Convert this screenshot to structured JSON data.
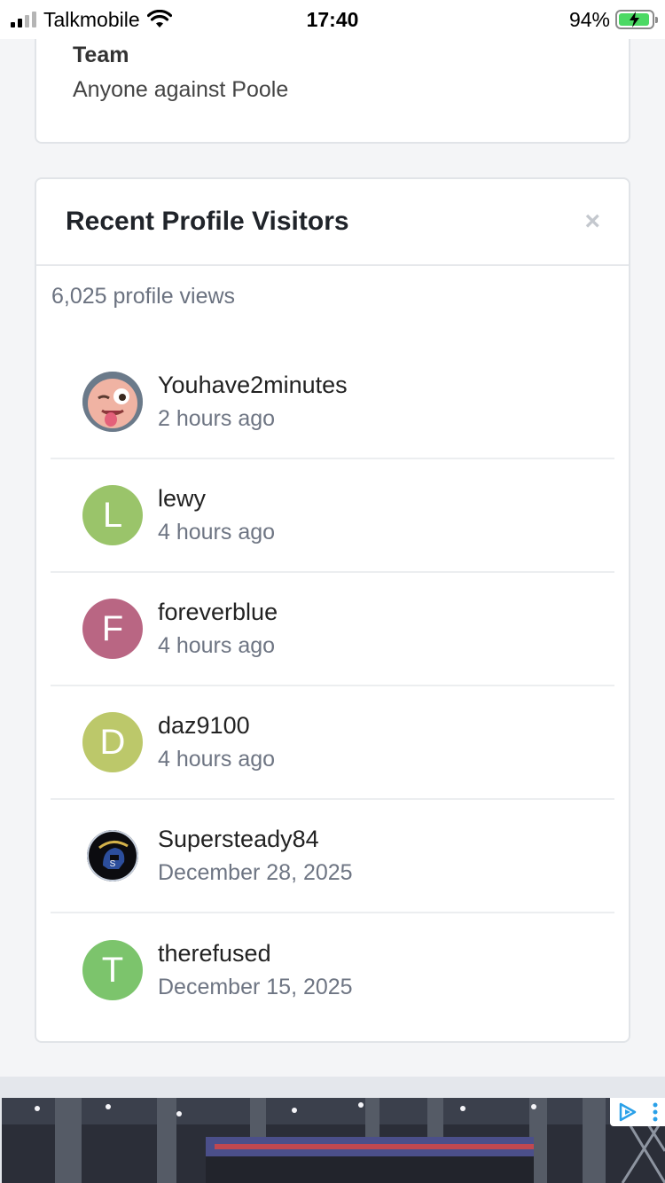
{
  "status_bar": {
    "carrier": "Talkmobile",
    "time": "17:40",
    "battery": "94%",
    "battery_level": 0.94
  },
  "profile_field": {
    "label": "Team",
    "value": "Anyone against Poole"
  },
  "visitors_card": {
    "title": "Recent Profile Visitors",
    "close_icon": "×",
    "views": "6,025 profile views",
    "visitors": [
      {
        "name": "Youhave2minutes",
        "time": "2 hours ago",
        "avatar": "photo-emoji",
        "initial": ""
      },
      {
        "name": "lewy",
        "time": "4 hours ago",
        "avatar_color": "#9ac46a",
        "initial": "L"
      },
      {
        "name": "foreverblue",
        "time": "4 hours ago",
        "avatar_color": "#b96683",
        "initial": "F"
      },
      {
        "name": "daz9100",
        "time": "4 hours ago",
        "avatar_color": "#bcc86a",
        "initial": "D"
      },
      {
        "name": "Supersteady84",
        "time": "December 28, 2025",
        "avatar": "photo-helmet",
        "initial": ""
      },
      {
        "name": "therefused",
        "time": "December 15, 2025",
        "avatar_color": "#7cc46c",
        "initial": "T"
      }
    ]
  },
  "ad": {
    "icons": [
      "adchoices-icon",
      "more-options-icon"
    ]
  }
}
